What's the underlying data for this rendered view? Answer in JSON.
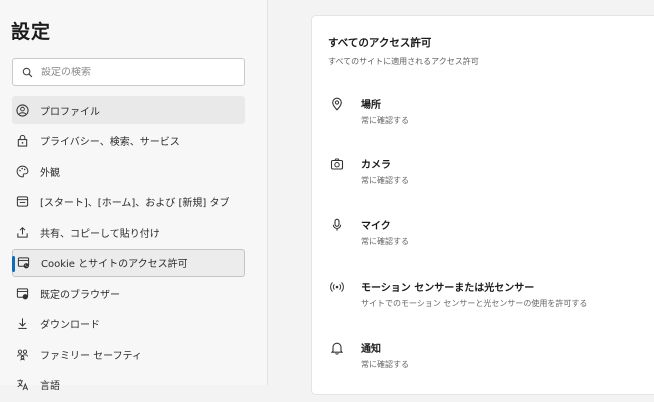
{
  "sidebar": {
    "title": "設定",
    "search": {
      "placeholder": "設定の検索"
    },
    "items": [
      {
        "label": "プロファイル",
        "icon": "profile-icon"
      },
      {
        "label": "プライバシー、検索、サービス",
        "icon": "lock-icon"
      },
      {
        "label": "外観",
        "icon": "appearance-icon"
      },
      {
        "label": "[スタート]、[ホーム]、および [新規] タブ",
        "icon": "tabs-icon"
      },
      {
        "label": "共有、コピーして貼り付け",
        "icon": "share-icon"
      },
      {
        "label": "Cookie とサイトのアクセス許可",
        "icon": "cookie-icon"
      },
      {
        "label": "既定のブラウザー",
        "icon": "browser-icon"
      },
      {
        "label": "ダウンロード",
        "icon": "download-icon"
      },
      {
        "label": "ファミリー セーフティ",
        "icon": "family-icon"
      },
      {
        "label": "言語",
        "icon": "language-icon"
      }
    ],
    "selected_index": 5
  },
  "main": {
    "header": {
      "title": "すべてのアクセス許可",
      "description": "すべてのサイトに適用されるアクセス許可"
    },
    "permissions": [
      {
        "title": "場所",
        "description": "常に確認する",
        "icon": "location-icon"
      },
      {
        "title": "カメラ",
        "description": "常に確認する",
        "icon": "camera-icon"
      },
      {
        "title": "マイク",
        "description": "常に確認する",
        "icon": "microphone-icon"
      },
      {
        "title": "モーション センサーまたは光センサー",
        "description": "サイトでのモーション センサーと光センサーの使用を許可する",
        "icon": "motion-sensor-icon"
      },
      {
        "title": "通知",
        "description": "常に確認する",
        "icon": "bell-icon"
      }
    ]
  },
  "colors": {
    "accent": "#0f6cbd",
    "sidebar_bg": "#f7f7f7",
    "page_bg": "#f3f3f3",
    "card_bg": "#ffffff"
  }
}
